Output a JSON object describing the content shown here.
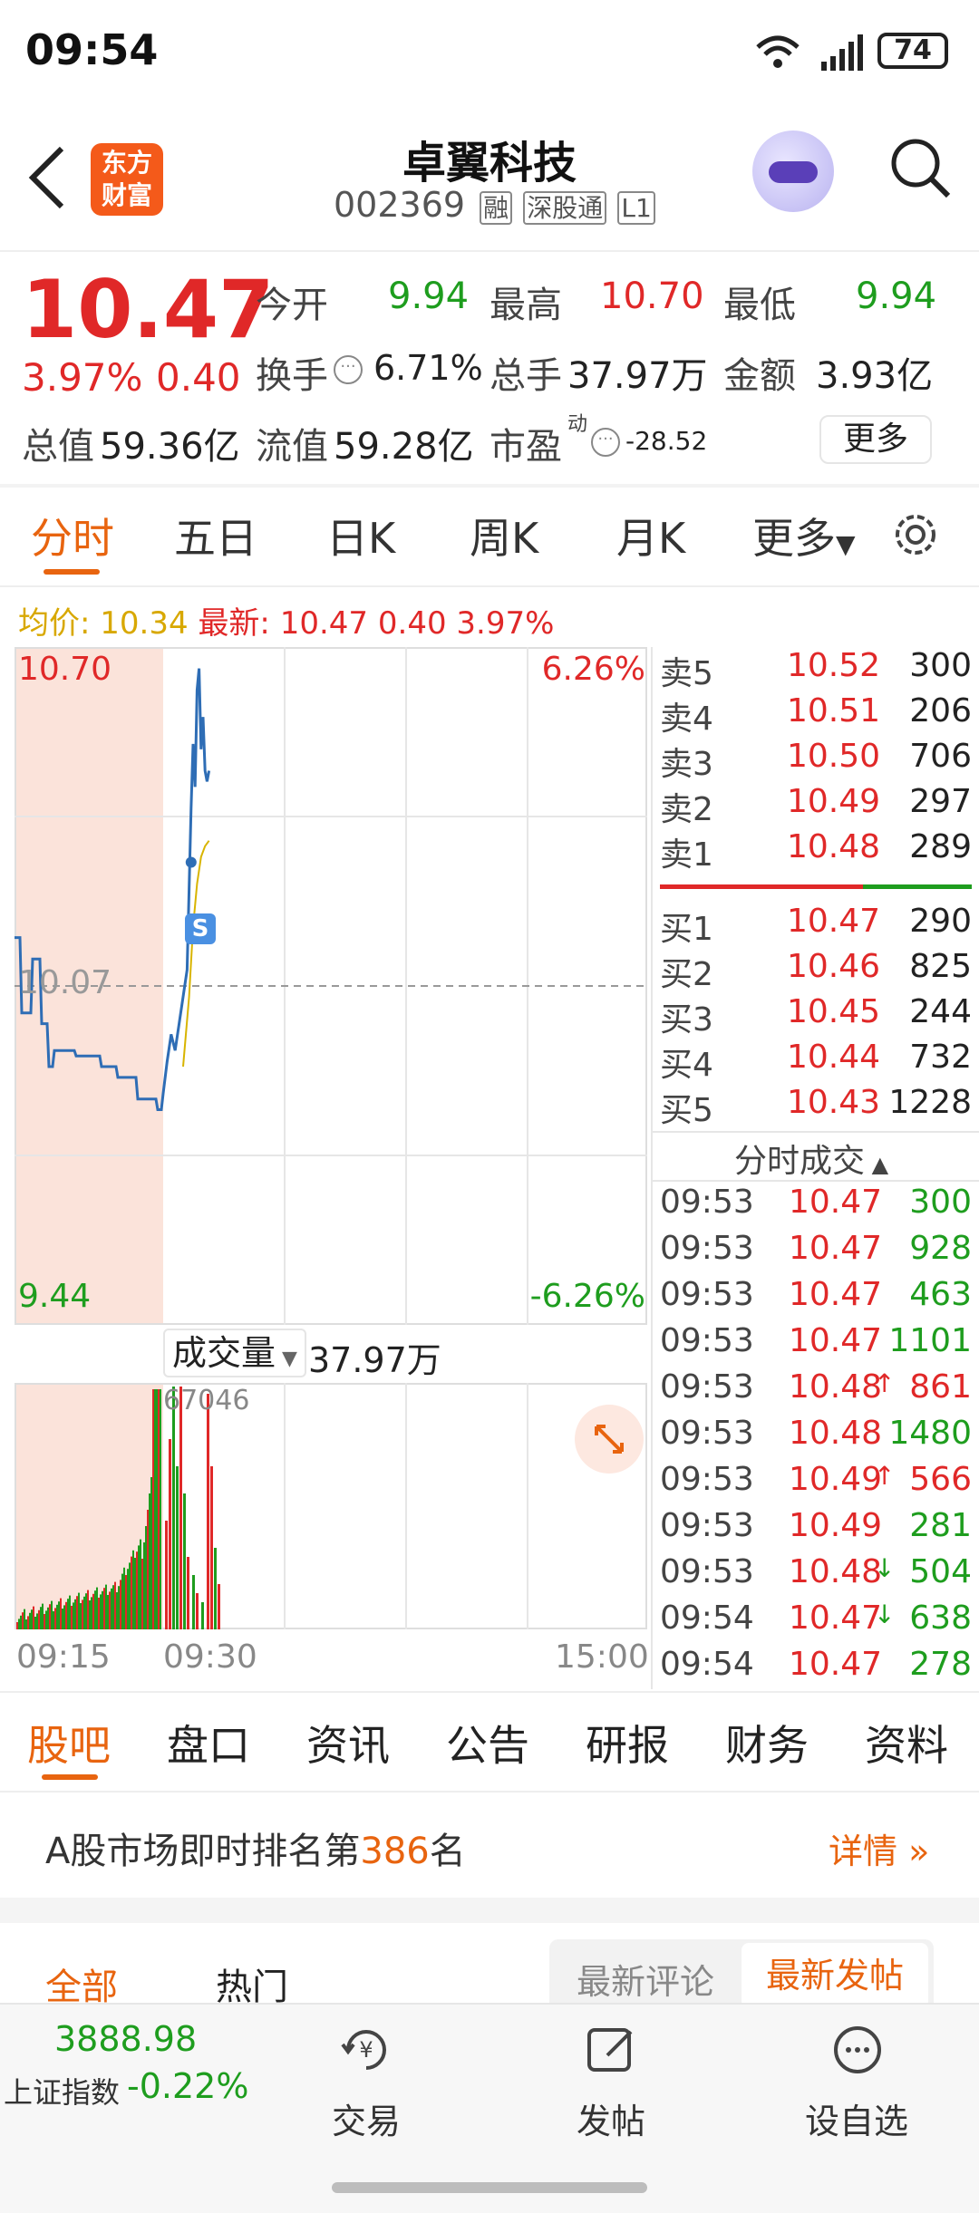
{
  "status_bar": {
    "time": "09:54",
    "battery": "74"
  },
  "header": {
    "back_icon": "chevron-left-icon",
    "logo_line1": "东方",
    "logo_line2": "财富",
    "stock_name": "卓翼科技",
    "stock_code": "002369",
    "tags": [
      "融",
      "深股通",
      "L1"
    ]
  },
  "quote": {
    "price": "10.47",
    "change_pct": "3.97%",
    "change": "0.40",
    "open_label": "今开",
    "open": "9.94",
    "high_label": "最高",
    "high": "10.70",
    "low_label": "最低",
    "low": "9.94",
    "turnover_label": "换手",
    "turnover": "6.71%",
    "volume_label": "总手",
    "volume": "37.97万",
    "amount_label": "金额",
    "amount": "3.93亿",
    "mktcap_label": "总值",
    "mktcap": "59.36亿",
    "float_label": "流值",
    "float": "59.28亿",
    "pe_label": "市盈",
    "pe_super": "动",
    "pe": "-28.52",
    "more_button": "更多"
  },
  "chart_tabs": {
    "items": [
      "分时",
      "五日",
      "日K",
      "周K",
      "月K",
      "更多"
    ],
    "active": "分时"
  },
  "info_line": {
    "avg_label": "均价:",
    "avg": "10.34",
    "latest_label": "最新:",
    "latest": "10.47",
    "change": "0.40",
    "pct": "3.97%"
  },
  "chart_labels": {
    "y_top": "10.70",
    "y_bottom": "9.44",
    "y_mid": "10.07",
    "pct_top": "6.26%",
    "pct_bottom": "-6.26%",
    "marker": "S",
    "volume_label": "成交量",
    "volume_total": "37.97万",
    "volume_max": "67046",
    "x_start": "09:15",
    "x_open": "09:30",
    "x_end": "15:00"
  },
  "chart_data": {
    "type": "line",
    "title": "",
    "ylim": [
      9.44,
      10.7
    ],
    "mid": 10.07,
    "series": [
      {
        "name": "最新",
        "color": "#2e6db5",
        "points": [
          [
            0,
            10.16
          ],
          [
            3,
            10.16
          ],
          [
            4,
            10.02
          ],
          [
            9,
            10.02
          ],
          [
            10,
            10.12
          ],
          [
            14,
            10.12
          ],
          [
            15,
            10.0
          ],
          [
            18,
            10.0
          ],
          [
            19,
            9.92
          ],
          [
            21,
            9.92
          ],
          [
            22,
            9.95
          ],
          [
            33,
            9.95
          ],
          [
            34,
            9.94
          ],
          [
            47,
            9.94
          ],
          [
            48,
            9.92
          ],
          [
            56,
            9.92
          ],
          [
            57,
            9.9
          ],
          [
            67,
            9.9
          ],
          [
            68,
            9.86
          ],
          [
            78,
            9.86
          ],
          [
            79,
            9.84
          ],
          [
            81,
            9.84
          ],
          [
            82,
            9.87
          ],
          [
            84,
            9.93
          ],
          [
            86,
            9.98
          ],
          [
            88,
            9.95
          ],
          [
            90,
            10.0
          ],
          [
            92,
            10.05
          ],
          [
            94,
            10.1
          ],
          [
            95,
            10.25
          ],
          [
            96,
            10.4
          ],
          [
            97,
            10.52
          ],
          [
            98,
            10.44
          ],
          [
            99,
            10.62
          ],
          [
            100,
            10.66
          ],
          [
            101,
            10.51
          ],
          [
            102,
            10.57
          ],
          [
            103,
            10.47
          ],
          [
            104,
            10.45
          ],
          [
            105,
            10.47
          ]
        ]
      },
      {
        "name": "均价",
        "color": "#d8b400",
        "points": [
          [
            92,
            9.92
          ],
          [
            95,
            10.05
          ],
          [
            97,
            10.18
          ],
          [
            99,
            10.26
          ],
          [
            101,
            10.31
          ],
          [
            103,
            10.33
          ],
          [
            105,
            10.34
          ]
        ]
      }
    ],
    "x_range": [
      0,
      390
    ]
  },
  "order_book": {
    "asks": [
      {
        "label": "卖5",
        "price": "10.52",
        "vol": "300"
      },
      {
        "label": "卖4",
        "price": "10.51",
        "vol": "206"
      },
      {
        "label": "卖3",
        "price": "10.50",
        "vol": "706"
      },
      {
        "label": "卖2",
        "price": "10.49",
        "vol": "297"
      },
      {
        "label": "卖1",
        "price": "10.48",
        "vol": "289"
      }
    ],
    "bids": [
      {
        "label": "买1",
        "price": "10.47",
        "vol": "290"
      },
      {
        "label": "买2",
        "price": "10.46",
        "vol": "825"
      },
      {
        "label": "买3",
        "price": "10.45",
        "vol": "244"
      },
      {
        "label": "买4",
        "price": "10.44",
        "vol": "732"
      },
      {
        "label": "买5",
        "price": "10.43",
        "vol": "1228"
      }
    ]
  },
  "trades": {
    "title": "分时成交",
    "rows": [
      {
        "time": "09:53",
        "price": "10.47",
        "arrow": "",
        "vol": "300",
        "vol_color": "green"
      },
      {
        "time": "09:53",
        "price": "10.47",
        "arrow": "",
        "vol": "928",
        "vol_color": "green"
      },
      {
        "time": "09:53",
        "price": "10.47",
        "arrow": "",
        "vol": "463",
        "vol_color": "green"
      },
      {
        "time": "09:53",
        "price": "10.47",
        "arrow": "",
        "vol": "1101",
        "vol_color": "green"
      },
      {
        "time": "09:53",
        "price": "10.48",
        "arrow": "↑",
        "vol": "861",
        "vol_color": "red"
      },
      {
        "time": "09:53",
        "price": "10.48",
        "arrow": "",
        "vol": "1480",
        "vol_color": "green"
      },
      {
        "time": "09:53",
        "price": "10.49",
        "arrow": "↑",
        "vol": "566",
        "vol_color": "red"
      },
      {
        "time": "09:53",
        "price": "10.49",
        "arrow": "",
        "vol": "281",
        "vol_color": "green"
      },
      {
        "time": "09:53",
        "price": "10.48",
        "arrow": "↓",
        "vol": "504",
        "vol_color": "green"
      },
      {
        "time": "09:54",
        "price": "10.47",
        "arrow": "↓",
        "vol": "638",
        "vol_color": "green"
      },
      {
        "time": "09:54",
        "price": "10.47",
        "arrow": "",
        "vol": "278",
        "vol_color": "green"
      }
    ]
  },
  "bottom_tabs": {
    "items": [
      "股吧",
      "盘口",
      "资讯",
      "公告",
      "研报",
      "财务",
      "资料"
    ],
    "active": "股吧"
  },
  "ranking": {
    "prefix": "A股市场即时排名第",
    "rank": "386",
    "suffix": "名",
    "detail": "详情"
  },
  "filters": {
    "all": "全部",
    "hot": "热门",
    "latest_comment": "最新评论",
    "latest_post": "最新发帖"
  },
  "bottom_nav": {
    "index_value": "3888.98",
    "index_name": "上证指数",
    "index_change": "-0.22%",
    "trade": "交易",
    "post": "发帖",
    "watchlist": "设自选"
  }
}
